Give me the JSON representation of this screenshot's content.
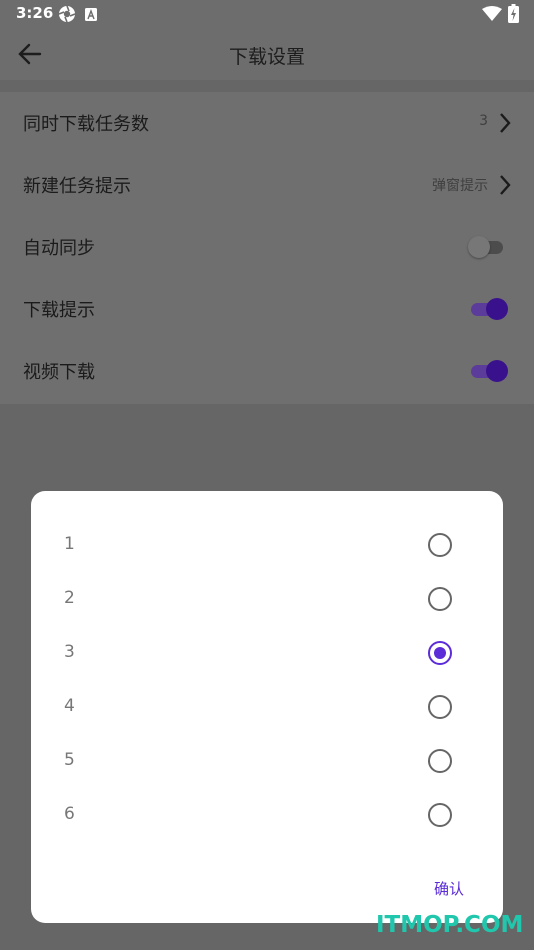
{
  "status_bar": {
    "time": "3:26",
    "icons": [
      "aperture-icon",
      "a-badge-icon",
      "wifi-icon",
      "battery-charging-icon"
    ]
  },
  "toolbar": {
    "title": "下载设置",
    "back_icon": "arrow-left-icon"
  },
  "settings": {
    "items": [
      {
        "label": "同时下载任务数",
        "value": "3",
        "control": "chevron"
      },
      {
        "label": "新建任务提示",
        "value": "弹窗提示",
        "control": "chevron"
      },
      {
        "label": "自动同步",
        "control": "switch",
        "on": false
      },
      {
        "label": "下载提示",
        "control": "switch",
        "on": true
      },
      {
        "label": "视频下载",
        "control": "switch",
        "on": true
      }
    ]
  },
  "dialog": {
    "options": [
      "1",
      "2",
      "3",
      "4",
      "5",
      "6"
    ],
    "selected": "3",
    "confirm_label": "确认"
  },
  "watermark": "ITMOP.COM",
  "colors": {
    "accent": "#5b2cd8",
    "switch_on": "#3a118c",
    "scrim": "#6f6f6f"
  }
}
